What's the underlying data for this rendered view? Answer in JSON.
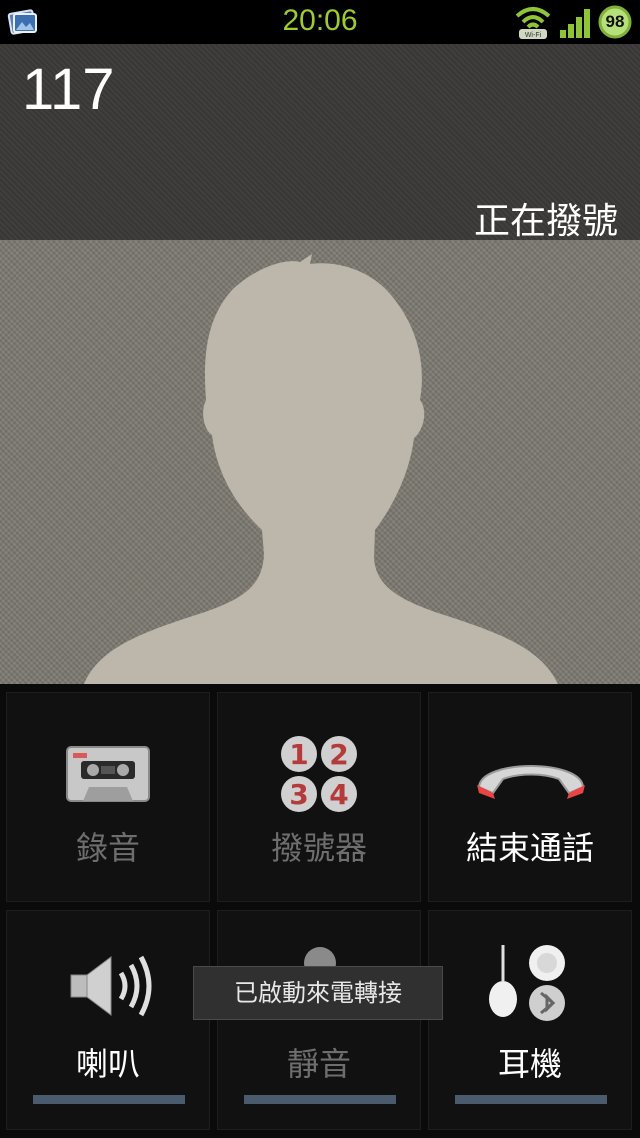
{
  "status_bar": {
    "time": "20:06",
    "battery": "98",
    "icons": [
      "gallery-notification-icon",
      "wifi-icon",
      "signal-icon",
      "battery-icon"
    ]
  },
  "call": {
    "number": "117",
    "status": "正在撥號"
  },
  "buttons": {
    "record": {
      "label": "錄音",
      "icon": "cassette-icon",
      "enabled": false
    },
    "dialpad": {
      "label": "撥號器",
      "icon": "dialpad-icon",
      "enabled": false
    },
    "end_call": {
      "label": "結束通話",
      "icon": "end-call-icon",
      "enabled": true
    },
    "speaker": {
      "label": "喇叭",
      "icon": "speaker-icon",
      "enabled": true
    },
    "mute": {
      "label": "靜音",
      "icon": "microphone-icon",
      "enabled": false
    },
    "headset": {
      "label": "耳機",
      "icon": "headset-bluetooth-icon",
      "enabled": true
    }
  },
  "toast": {
    "text": "已啟動來電轉接"
  },
  "colors": {
    "time": "#9ccc2e",
    "end_call_red": "#e94545",
    "toggle_bar": "#4a5b6e"
  }
}
